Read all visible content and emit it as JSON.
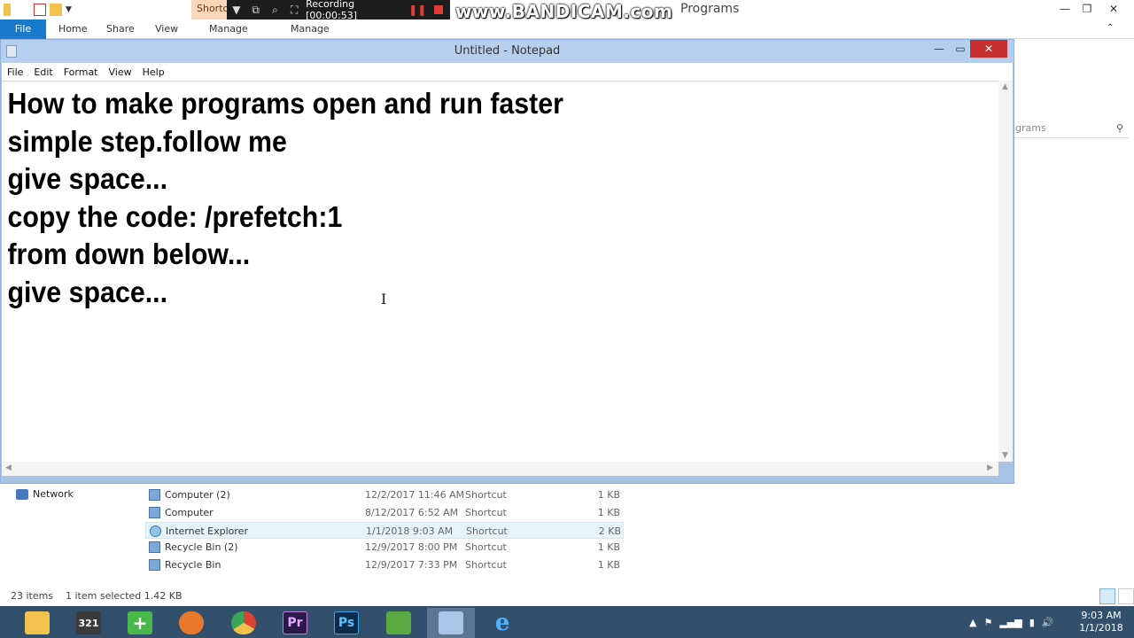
{
  "explorer": {
    "title": "Programs",
    "contextual_tab_fragment": "Shortc",
    "ribbon_tabs": [
      "File",
      "Home",
      "Share",
      "View",
      "Manage",
      "Manage"
    ],
    "search_placeholder": "grams"
  },
  "recorder": {
    "recording_text": "Recording [00:00:53]",
    "watermark": "www.BANDICAM.com"
  },
  "notepad": {
    "title": "Untitled - Notepad",
    "menu": [
      "File",
      "Edit",
      "Format",
      "View",
      "Help"
    ],
    "lines": [
      "How to make programs open and run faster",
      "simple step.follow me",
      "give space...",
      "copy the code: /prefetch:1",
      "from down below...",
      "give space..."
    ]
  },
  "nav": {
    "network_label": "Network"
  },
  "files": [
    {
      "name": "Computer (2)",
      "date": "12/2/2017 11:46 AM",
      "type": "Shortcut",
      "size": "1 KB",
      "selected": false
    },
    {
      "name": "Computer",
      "date": "8/12/2017 6:52 AM",
      "type": "Shortcut",
      "size": "1 KB",
      "selected": false
    },
    {
      "name": "Internet Explorer",
      "date": "1/1/2018 9:03 AM",
      "type": "Shortcut",
      "size": "2 KB",
      "selected": true
    },
    {
      "name": "Recycle Bin (2)",
      "date": "12/9/2017 8:00 PM",
      "type": "Shortcut",
      "size": "1 KB",
      "selected": false
    },
    {
      "name": "Recycle Bin",
      "date": "12/9/2017 7:33 PM",
      "type": "Shortcut",
      "size": "1 KB",
      "selected": false
    }
  ],
  "status": {
    "item_count": "23 items",
    "selection": "1 item selected  1.42 KB"
  },
  "taskbar": {
    "apps": [
      {
        "name": "file-explorer",
        "glyph": "",
        "color": "#f2c14e"
      },
      {
        "name": "video-app",
        "glyph": "321",
        "color": "#3a3a3a"
      },
      {
        "name": "download-app",
        "glyph": "+",
        "color": "#49b84a"
      },
      {
        "name": "firefox",
        "glyph": "",
        "color": "#e8792a"
      },
      {
        "name": "chrome",
        "glyph": "",
        "color": "#d94334"
      },
      {
        "name": "premiere",
        "glyph": "Pr",
        "color": "#2a1a4a"
      },
      {
        "name": "photoshop",
        "glyph": "Ps",
        "color": "#0c2b4a"
      },
      {
        "name": "network-app",
        "glyph": "",
        "color": "#5aa842"
      },
      {
        "name": "notepad",
        "glyph": "",
        "color": "#a7c6e8"
      },
      {
        "name": "internet-explorer",
        "glyph": "e",
        "color": "#1e88e5"
      }
    ],
    "time": "9:03 AM",
    "date": "1/1/2018"
  }
}
